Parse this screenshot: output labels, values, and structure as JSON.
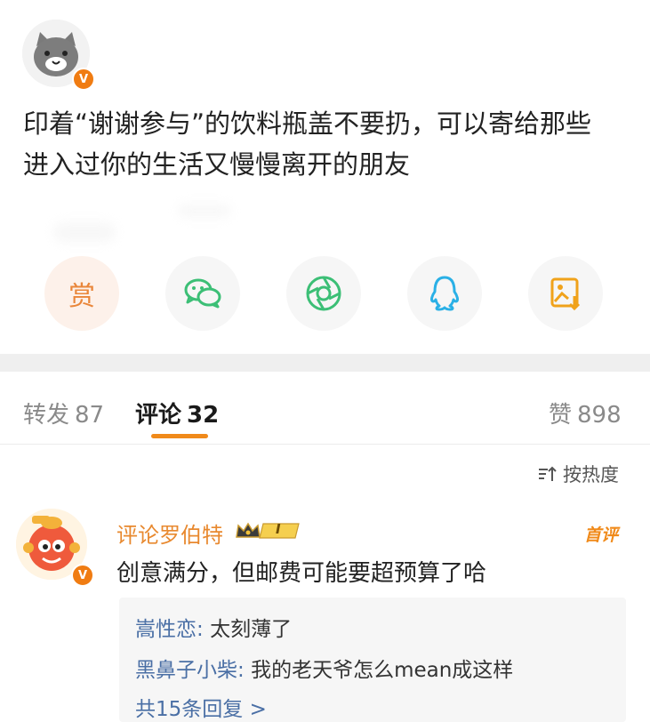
{
  "post": {
    "line1": "印着“谢谢参与”的饮料瓶盖不要扔，可以寄给那些",
    "line2": "进入过你的生活又慢慢离开的朋友",
    "verified_badge": "V"
  },
  "share": {
    "reward_label": "赏",
    "items": [
      "reward-icon",
      "wechat-icon",
      "moments-icon",
      "qq-icon",
      "save-image-icon"
    ]
  },
  "tabs": {
    "repost_label": "转发",
    "repost_count": "87",
    "comments_label": "评论",
    "comments_count": "32",
    "likes_label": "赞",
    "likes_count": "898"
  },
  "sort": {
    "label": "按热度"
  },
  "comment": {
    "username": "评论罗伯特",
    "level_badge": "I",
    "verified_badge": "V",
    "first_tag": "首评",
    "text": "创意满分，但邮费可能要超预算了哈",
    "replies": [
      {
        "name": "嵩性恋",
        "text": "太刻薄了"
      },
      {
        "name": "黑鼻子小柴",
        "text": "我的老天爷怎么mean成这样"
      }
    ],
    "more_replies": "共15条回复 >"
  },
  "colors": {
    "accent": "#f08a1a",
    "username": "#e8892f",
    "reply_name": "#4a6fa5",
    "band": "#efefef"
  }
}
